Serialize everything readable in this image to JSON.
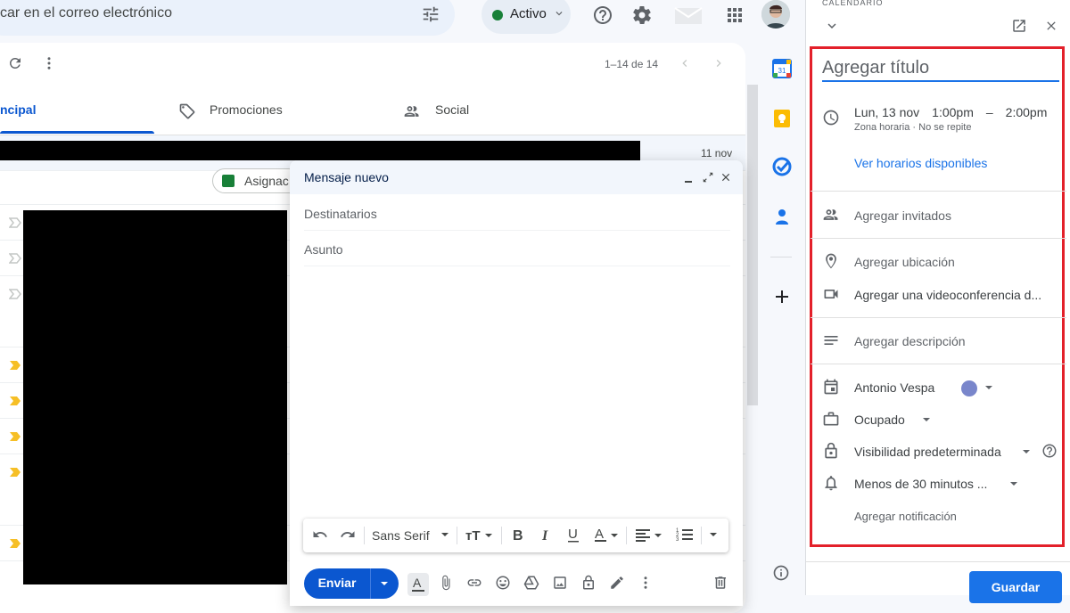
{
  "header": {
    "search_text": "car en el correo electrónico",
    "status_label": "Activo"
  },
  "mail_toolbar": {
    "pager": "1–14 de 14"
  },
  "tabs": [
    {
      "label": "ncipal"
    },
    {
      "label": "Promociones"
    },
    {
      "label": "Social"
    }
  ],
  "mail_list": {
    "first_date": "11 nov",
    "chip_label": "Asignac"
  },
  "compose": {
    "title": "Mensaje nuevo",
    "to_placeholder": "Destinatarios",
    "subject_placeholder": "Asunto",
    "font_name": "Sans Serif",
    "send_label": "Enviar"
  },
  "event_panel": {
    "app_label": "CALENDARIO",
    "title_placeholder": "Agregar título",
    "date": "Lun, 13 nov",
    "start_time": "1:00pm",
    "dash": "–",
    "end_time": "2:00pm",
    "time_sub": "Zona horaria · No se repite",
    "availability_link": "Ver horarios disponibles",
    "guests": "Agregar invitados",
    "location": "Agregar ubicación",
    "video": "Agregar una videoconferencia d...",
    "description": "Agregar descripción",
    "calendar_owner": "Antonio Vespa",
    "calendar_color": "#7986cb",
    "busy": "Ocupado",
    "visibility": "Visibilidad predeterminada",
    "reminder": "Menos de 30 minutos ...",
    "add_notification": "Agregar notificación",
    "save_label": "Guardar"
  },
  "colors": {
    "accent": "#0b57d0",
    "calendar_blue": "#1a73e8",
    "highlight_box": "#e3202a",
    "important_marker": "#f6bf26"
  }
}
